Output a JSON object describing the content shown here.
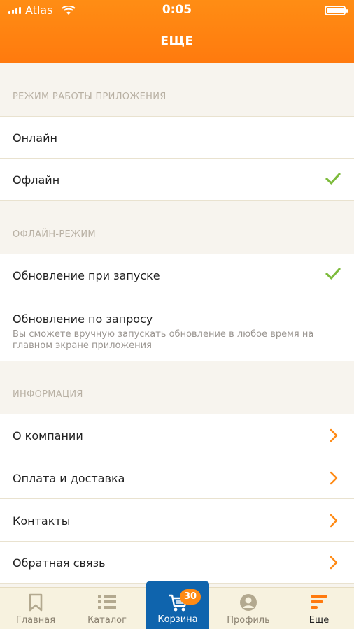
{
  "status_bar": {
    "carrier": "Atlas",
    "time": "0:05"
  },
  "header": {
    "title": "ЕЩЕ"
  },
  "sections": {
    "mode": {
      "title": "РЕЖИМ РАБОТЫ ПРИЛОЖЕНИЯ",
      "items": [
        {
          "label": "Онлайн",
          "checked": false
        },
        {
          "label": "Офлайн",
          "checked": true
        }
      ]
    },
    "offline": {
      "title": "ОФЛАЙН-РЕЖИМ",
      "items": [
        {
          "label": "Обновление при запуске",
          "checked": true
        },
        {
          "label": "Обновление по запросу",
          "subtitle": "Вы сможете вручную запускать обновление в любое время на главном экране приложения",
          "checked": false
        }
      ]
    },
    "info": {
      "title": "ИНФОРМАЦИЯ",
      "items": [
        {
          "label": "О компании"
        },
        {
          "label": "Оплата и доставка"
        },
        {
          "label": "Контакты"
        },
        {
          "label": "Обратная связь"
        }
      ]
    }
  },
  "tabbar": {
    "items": [
      {
        "label": "Главная",
        "icon": "bookmark-icon"
      },
      {
        "label": "Каталог",
        "icon": "list-icon"
      },
      {
        "label": "Корзина",
        "icon": "cart-icon",
        "badge": "30",
        "active": true
      },
      {
        "label": "Профиль",
        "icon": "user-icon"
      },
      {
        "label": "Еще",
        "icon": "more-lines-icon"
      }
    ]
  },
  "colors": {
    "accent": "#ff7a0e",
    "check": "#7dbb3c",
    "chevron": "#ff8a14",
    "active_tab": "#0f64ad"
  }
}
